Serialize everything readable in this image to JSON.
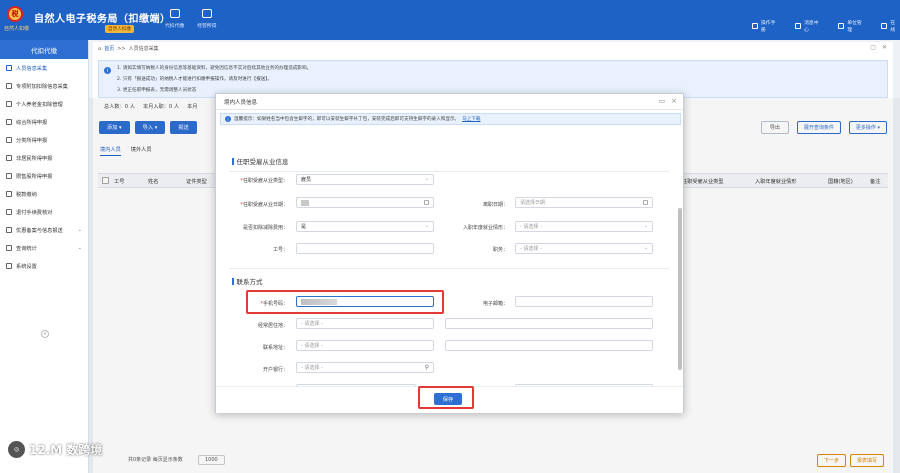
{
  "app": {
    "logo_sub": "自然人扣缴",
    "title": "自然人电子税务局（扣缴端）",
    "badge": "自然人扣缴"
  },
  "topnav": [
    {
      "label": "代扣代缴"
    },
    {
      "label": "经营所得"
    }
  ],
  "rightnav": [
    {
      "label": "操作手册"
    },
    {
      "label": "消息中心"
    },
    {
      "label": "单位管理"
    },
    {
      "label": "在线"
    }
  ],
  "sidebar": {
    "header": "代扣代缴",
    "items": [
      {
        "label": "人员信息采集",
        "active": true
      },
      {
        "label": "专项附加扣除信息采集"
      },
      {
        "label": "个人养老金扣除管理"
      },
      {
        "label": "综合所得申报"
      },
      {
        "label": "分类所得申报"
      },
      {
        "label": "非居民所得申报"
      },
      {
        "label": "限售股所得申报"
      },
      {
        "label": "税款缴纳"
      },
      {
        "label": "退付手续费核对"
      },
      {
        "label": "优惠备案与信息报送",
        "chevron": true
      },
      {
        "label": "查询统计",
        "chevron": true
      },
      {
        "label": "系统设置"
      }
    ]
  },
  "breadcrumb": {
    "home": "首页",
    "sep": ">>",
    "current": "人员信息采集"
  },
  "notice": {
    "lines": [
      "1. 请如实填写纳税人的身份信息等基础资料，避免因信息不实对后续其他业务的办理造成影响。",
      "2. 只有「报送成功」的纳税人才能进行扣缴申报操作，请及时进行【报送】。",
      "3. 更正任职申报表，无需调整人员状态"
    ]
  },
  "stats": {
    "total_label": "总人数：",
    "total_value": "0",
    "unit1": "人",
    "month_label": "本月入职：",
    "month_value": "0",
    "unit2": "人",
    "more": "本月"
  },
  "toolbar": {
    "add": "添加",
    "import": "导入",
    "submit": "报送"
  },
  "rightbtns": {
    "export": "导出",
    "expand": "展开查询条件",
    "more": "更多操作"
  },
  "tabs": [
    {
      "label": "境内人员",
      "active": true
    },
    {
      "label": "境外人员"
    }
  ],
  "table": {
    "headers": [
      "工号",
      "姓名",
      "证件类型",
      "任职受雇从业类型",
      "入职年度就业情形",
      "国籍(地区)",
      "备注"
    ]
  },
  "footer": {
    "record_text": "共0条记录  每页显示条数",
    "page_size": "1000",
    "prev": "下一步",
    "next": "报表填写"
  },
  "watermark": {
    "text": "12.M  数跨境"
  },
  "modal": {
    "title": "境内人员信息",
    "tip": "温馨提示：如果姓名当中包含生僻字的，即可以安装生僻字补丁包，安装完成后即可支持生僻字的录入和显示。",
    "tip_link": "马上下载",
    "employment": {
      "section": "任职受雇从业信息",
      "type_label": "任职受雇从业类型：",
      "type_value": "雇员",
      "date_label": "任职受雇从业日期：",
      "leave_label": "离职日期：",
      "leave_placeholder": "请选择日期",
      "deduct_label": "是否扣除减除费用：",
      "deduct_value": "是",
      "yearstatus_label": "入职年度就业情形：",
      "yearstatus_placeholder": "- 请选择 -",
      "id_label": "工号：",
      "position_label": "职务：",
      "position_placeholder": "- 请选择 -"
    },
    "contact": {
      "section": "联系方式",
      "phone_label": "手机号码：",
      "email_label": "电子邮箱：",
      "residence_label": "经常居住地：",
      "residence_placeholder": "- 请选择 -",
      "address_label": "联系地址：",
      "address_placeholder": "- 请选择 -",
      "bank_label": "开户银行：",
      "bank_placeholder": "- 请选择 -"
    },
    "save": "保存"
  },
  "colors": {
    "primary": "#1e62c6",
    "button": "#2d6fd3",
    "highlight": "#e53935"
  }
}
